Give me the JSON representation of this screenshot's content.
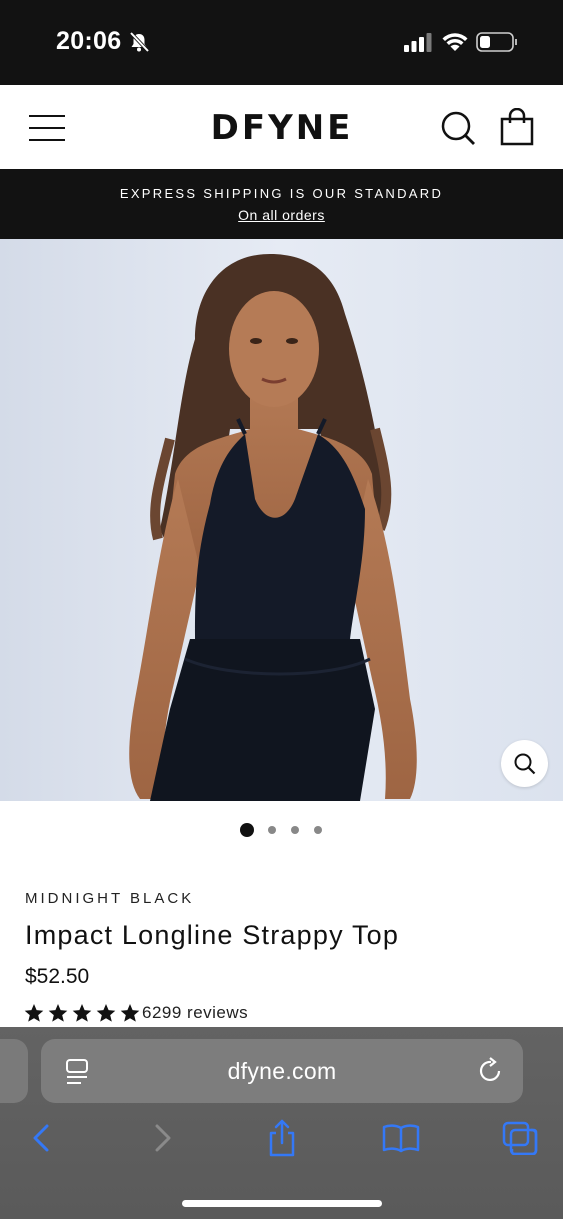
{
  "status_bar": {
    "time": "20:06"
  },
  "header": {
    "brand": "DFYNE",
    "icons": [
      "menu-icon",
      "search-icon",
      "bag-icon"
    ]
  },
  "announcement": {
    "title": "EXPRESS SHIPPING IS OUR STANDARD",
    "link": "On all orders"
  },
  "gallery": {
    "image_count": 4,
    "active_index": 0
  },
  "product": {
    "color": "MIDNIGHT BLACK",
    "title": "Impact Longline Strappy Top",
    "price": "$52.50",
    "rating_stars": 5,
    "reviews": "6299 reviews"
  },
  "browser": {
    "url": "dfyne.com",
    "toolbar": [
      "back-icon",
      "forward-icon",
      "share-icon",
      "bookmarks-icon",
      "tabs-icon"
    ]
  },
  "colors": {
    "accent": "#3478f6",
    "dark": "#121212"
  }
}
